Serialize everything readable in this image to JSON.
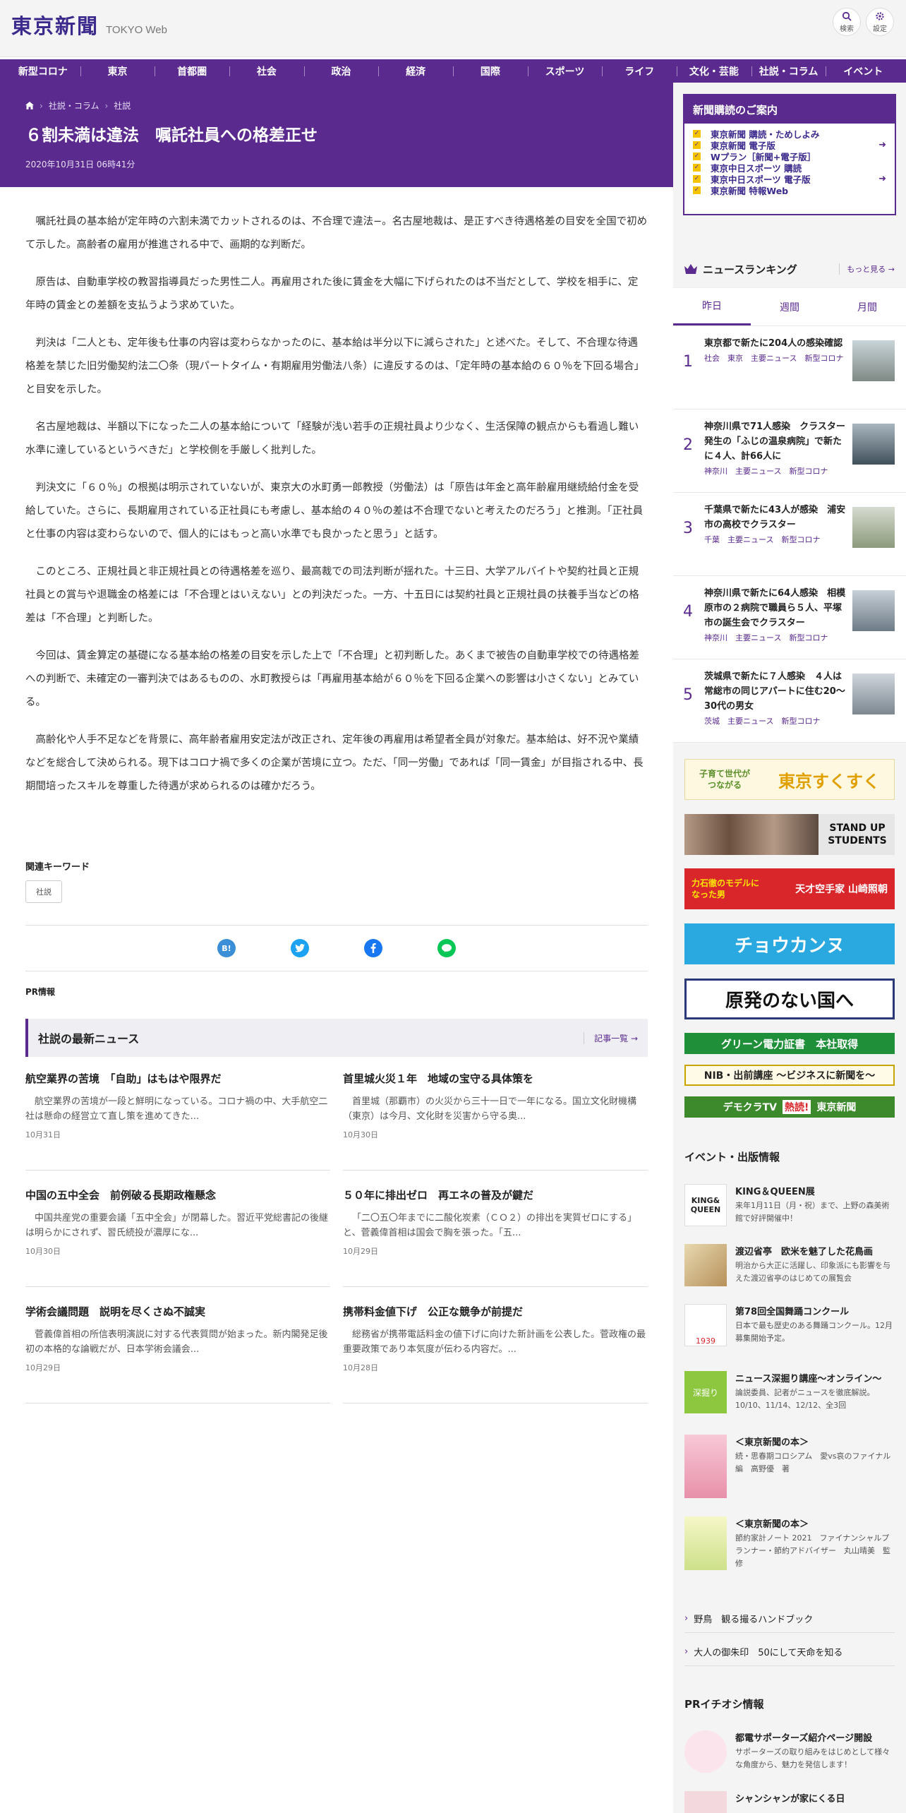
{
  "header": {
    "logo_jp": "東京新聞",
    "logo_en": "TOKYO Web",
    "search_label": "検索",
    "settings_label": "設定"
  },
  "nav": [
    "新型コロナ",
    "東京",
    "首都圏",
    "社会",
    "政治",
    "経済",
    "国際",
    "スポーツ",
    "ライフ",
    "文化・芸能",
    "社説・コラム",
    "イベント"
  ],
  "breadcrumb": [
    "社説・コラム",
    "社説"
  ],
  "article": {
    "title": "６割未満は違法　嘱託社員への格差正せ",
    "date": "2020年10月31日 06時41分",
    "paragraphs": [
      "嘱託社員の基本給が定年時の六割未満でカットされるのは、不合理で違法−。名古屋地裁は、是正すべき待遇格差の目安を全国で初めて示した。高齢者の雇用が推進される中で、画期的な判断だ。",
      "原告は、自動車学校の教習指導員だった男性二人。再雇用された後に賃金を大幅に下げられたのは不当だとして、学校を相手に、定年時の賃金との差額を支払うよう求めていた。",
      "判決は「二人とも、定年後も仕事の内容は変わらなかったのに、基本給は半分以下に減らされた」と述べた。そして、不合理な待遇格差を禁じた旧労働契約法二〇条（現パートタイム・有期雇用労働法八条）に違反するのは、「定年時の基本給の６０％を下回る場合」と目安を示した。",
      "名古屋地裁は、半額以下になった二人の基本給について「経験が浅い若手の正規社員より少なく、生活保障の観点からも看過し難い水準に達しているというべきだ」と学校側を手厳しく批判した。",
      "判決文に「６０％」の根拠は明示されていないが、東京大の水町勇一郎教授（労働法）は「原告は年金と高年齢雇用継続給付金を受給していた。さらに、長期雇用されている正社員にも考慮し、基本給の４０％の差は不合理でないと考えたのだろう」と推測。「正社員と仕事の内容は変わらないので、個人的にはもっと高い水準でも良かったと思う」と話す。",
      "このところ、正規社員と非正規社員との待遇格差を巡り、最高裁での司法判断が揺れた。十三日、大学アルバイトや契約社員と正規社員との賞与や退職金の格差には「不合理とはいえない」との判決だった。一方、十五日には契約社員と正規社員の扶養手当などの格差は「不合理」と判断した。",
      "今回は、賃金算定の基礎になる基本給の格差の目安を示した上で「不合理」と初判断した。あくまで被告の自動車学校での待遇格差への判断で、未確定の一審判決ではあるものの、水町教授らは「再雇用基本給が６０％を下回る企業への影響は小さくない」とみている。",
      "高齢化や人手不足などを背景に、高年齢者雇用安定法が改正され、定年後の再雇用は希望者全員が対象だ。基本給は、好不況や業績などを総合して決められる。現下はコロナ禍で多くの企業が苦境に立つ。ただ、「同一労働」であれば「同一賃金」が目指される中、長期間培ったスキルを尊重した待遇が求められるのは確かだろう。"
    ]
  },
  "keywords": {
    "title": "関連キーワード",
    "tag": "社説"
  },
  "share": {
    "hatena": "B!"
  },
  "pr_label": "PR情報",
  "latest": {
    "title": "社説の最新ニュース",
    "more": "記事一覧",
    "items": [
      {
        "title": "航空業界の苦境　「自助」はもはや限界だ",
        "text": "航空業界の苦境が一段と鮮明になっている。コロナ禍の中、大手航空二社は懸命の経営立て直し策を進めてきた...",
        "date": "10月31日"
      },
      {
        "title": "首里城火災１年　地域の宝守る具体策を",
        "text": "首里城（那覇市）の火災から三十一日で一年になる。国立文化財機構（東京）は今月、文化財を災害から守る奥...",
        "date": "10月30日"
      },
      {
        "title": "中国の五中全会　前例破る長期政権懸念",
        "text": "中国共産党の重要会議「五中全会」が閉幕した。習近平党総書記の後継は明らかにされず、習氏続投が濃厚にな...",
        "date": "10月30日"
      },
      {
        "title": "５０年に排出ゼロ　再エネの普及が鍵だ",
        "text": "「二〇五〇年までに二酸化炭素（ＣＯ２）の排出を実質ゼロにする」と、菅義偉首相は国会で胸を張った。「五...",
        "date": "10月29日"
      },
      {
        "title": "学術会議問題　説明を尽くさぬ不誠実",
        "text": "菅義偉首相の所信表明演説に対する代表質問が始まった。新内閣発足後初の本格的な論戦だが、日本学術会議会...",
        "date": "10月29日"
      },
      {
        "title": "携帯料金値下げ　公正な競争が前提だ",
        "text": "総務省が携帯電話料金の値下げに向けた新計画を公表した。菅政権の最重要政策であり本気度が伝わる内容だ。...",
        "date": "10月28日"
      }
    ]
  },
  "subscribe": {
    "title": "新聞購読のご案内",
    "items": [
      "東京新聞 購読・ためしよみ",
      "東京新聞 電子版",
      "Wプラン［新聞+電子版］",
      "東京中日スポーツ 購読",
      "東京中日スポーツ 電子版",
      "東京新聞 特報Web"
    ]
  },
  "ranking": {
    "title": "ニュースランキング",
    "more": "もっと見る",
    "tabs": [
      "昨日",
      "週間",
      "月間"
    ],
    "items": [
      {
        "num": "1",
        "title": "東京都で新たに204人の感染確認",
        "tags": "社会　東京　主要ニュース　新型コロナ"
      },
      {
        "num": "2",
        "title": "神奈川県で71人感染　クラスター発生の「ふじの温泉病院」で新たに４人、計66人に",
        "tags": "神奈川　主要ニュース　新型コロナ"
      },
      {
        "num": "3",
        "title": "千葉県で新たに43人が感染　浦安市の高校でクラスター",
        "tags": "千葉　主要ニュース　新型コロナ"
      },
      {
        "num": "4",
        "title": "神奈川県で新たに64人感染　相模原市の２病院で職員ら５人、平塚市の誕生会でクラスター",
        "tags": "神奈川　主要ニュース　新型コロナ"
      },
      {
        "num": "5",
        "title": "茨城県で新たに７人感染　４人は常総市の同じアパートに住む20～30代の男女",
        "tags": "茨城　主要ニュース　新型コロナ"
      }
    ]
  },
  "banners": {
    "sukusuku_top": "子育て世代が",
    "sukusuku_sub": "つながる",
    "sukusuku_main": "東京すくすく",
    "students": "STAND UP STUDENTS",
    "yamazaki_left": "力石徹のモデルになった男",
    "yamazaki_right": "天才空手家 山崎照朝",
    "chokanzu": "チョウカンヌ",
    "genpatsu": "原発のない国へ",
    "green": "グリーン電力証書　本社取得",
    "nib": "NIB・出前講座 ～ビジネスに新聞を～",
    "democra_left": "デモクラTV",
    "democra_mid": "熱読!",
    "democra_right": "東京新聞"
  },
  "events": {
    "title": "イベント・出版情報",
    "items": [
      {
        "title": "KING＆QUEEN展",
        "desc": "来年1月11日（月・祝）まで、上野の森美術館で好評開催中！",
        "img_text": "KING& QUEEN"
      },
      {
        "title": "渡辺省亭　欧米を魅了した花鳥画",
        "desc": "明治から大正に活躍し、印象派にも影響を与えた渡辺省亭のはじめての展覧会",
        "img_text": ""
      },
      {
        "title": "第78回全国舞踊コンクール",
        "desc": "日本で最も歴史のある舞踊コンクール。12月募集開始予定。",
        "img_text": "1939"
      },
      {
        "title": "ニュース深掘り講座～オンライン～",
        "desc": "論説委員、記者がニュースを徹底解説。10/10、11/14、12/12、全3回",
        "img_text": "深掘り"
      },
      {
        "title": "＜東京新聞の本＞",
        "desc": "続・思春期コロシアム　愛vs哀のファイナル編　高野優　著",
        "img_text": ""
      },
      {
        "title": "＜東京新聞の本＞",
        "desc": "節約家計ノート 2021　ファイナンシャルプランナー・節約アドバイザー　丸山晴美　監修",
        "img_text": ""
      }
    ]
  },
  "links": [
    "野鳥　観る撮るハンドブック",
    "大人の御朱印　50にして天命を知る"
  ],
  "pr_pick": {
    "title": "PRイチオシ情報",
    "items": [
      {
        "title": "都電サポーターズ紹介ページ開設",
        "desc": "サポーターズの取り組みをはじめとして様々な角度から、魅力を発信します！"
      },
      {
        "title": "シャンシャンが家にくる日",
        "desc": ""
      }
    ]
  },
  "colors": {
    "brand": "#5a2a8f",
    "accent": "#f5c400"
  }
}
